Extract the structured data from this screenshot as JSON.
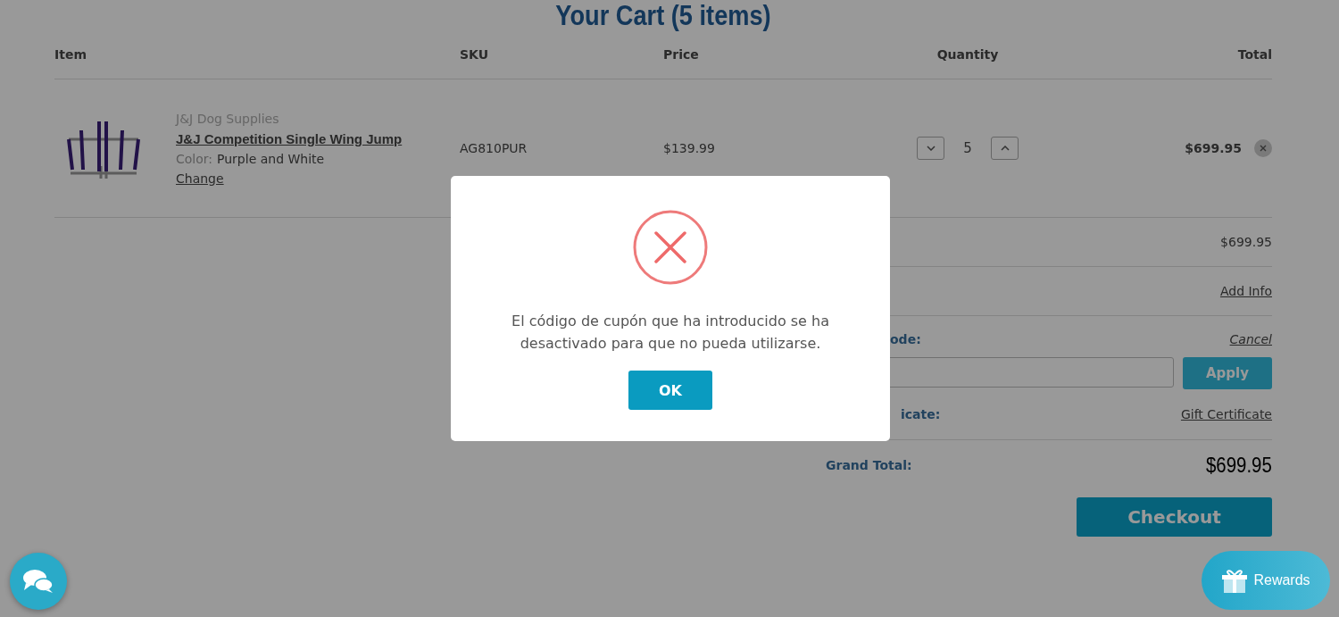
{
  "page_title": "Your Cart (5 items)",
  "table": {
    "columns": [
      "Item",
      "SKU",
      "Price",
      "Quantity",
      "Total"
    ],
    "rows": [
      {
        "brand": "J&J Dog Supplies",
        "name": "J&J Competition Single Wing Jump",
        "option_label": "Color:",
        "option_value": "Purple and White",
        "change_link": "Change",
        "sku": "AG810PUR",
        "price": "$139.99",
        "quantity": "5",
        "total": "$699.95"
      }
    ]
  },
  "summary": {
    "rows": [
      {
        "kind": "value",
        "value": "$699.95"
      },
      {
        "kind": "link",
        "value": "Add Info"
      },
      {
        "kind": "coupon",
        "label": "ode:",
        "link": "Cancel",
        "button": "Apply"
      },
      {
        "kind": "link",
        "label": "icate:",
        "value": "Gift Certificate"
      }
    ],
    "grand_total": {
      "label": "Grand Total:",
      "value": "$699.95"
    },
    "checkout": "Checkout"
  },
  "dialog": {
    "message": "El código de cupón que ha introducido se ha desactivado para que no pueda utilizarse.",
    "button": "OK"
  },
  "rewards": "Rewards"
}
